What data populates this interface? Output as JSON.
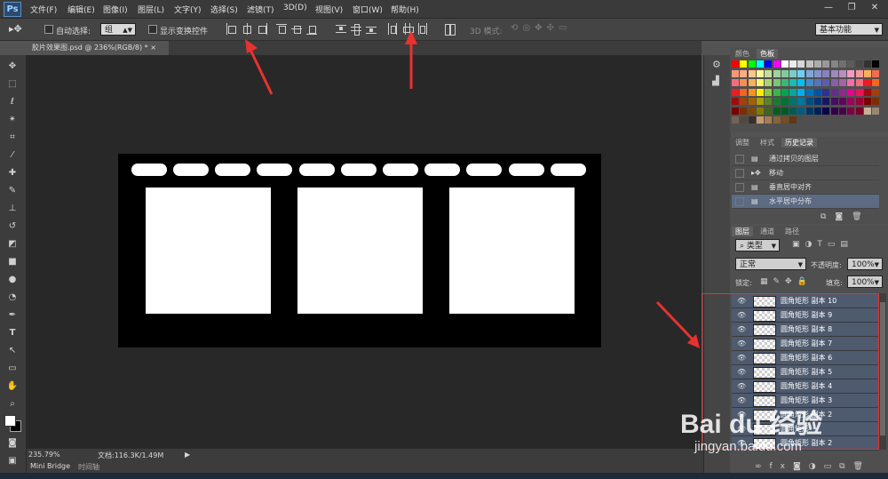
{
  "app": {
    "logo": "Ps"
  },
  "menu": [
    "文件(F)",
    "编辑(E)",
    "图像(I)",
    "图层(L)",
    "文字(Y)",
    "选择(S)",
    "滤镜(T)",
    "3D(D)",
    "视图(V)",
    "窗口(W)",
    "帮助(H)"
  ],
  "window_controls": [
    "—",
    "❐",
    "✕"
  ],
  "options": {
    "auto_select_label": "自动选择:",
    "auto_select_value": "组",
    "show_transform_label": "显示变换控件",
    "mode_3d_label": "3D 模式:",
    "workspace_value": "基本功能"
  },
  "document": {
    "tab_title": "胶片效果图.psd @ 236%(RGB/8) *",
    "tab_close": "×"
  },
  "status": {
    "zoom": "235.79%",
    "doc_info": "文档:116.3K/1.49M"
  },
  "bottom_tabs": [
    "Mini Bridge",
    "时间轴"
  ],
  "panels": {
    "color_tabs": [
      "颜色",
      "色板"
    ],
    "history_tabs": [
      "调整",
      "样式",
      "历史记录"
    ],
    "history_items": [
      "通过拷贝的图层",
      "移动",
      "垂直居中对齐",
      "水平居中分布"
    ],
    "layers_tabs": [
      "图层",
      "通道",
      "路径"
    ],
    "kind_label": "类型",
    "blend_mode": "正常",
    "opacity_label": "不透明度:",
    "opacity_value": "100%",
    "lock_label": "锁定:",
    "fill_label": "填充:",
    "fill_value": "100%",
    "layers": [
      "圆角矩形 副本 10",
      "圆角矩形 副本 9",
      "圆角矩形 副本 8",
      "圆角矩形 副本 7",
      "圆角矩形 副本 6",
      "圆角矩形 副本 5",
      "圆角矩形 副本 4",
      "圆角矩形 副本 3",
      "圆角矩形 副本 2",
      "圆角矩形",
      "圆角矩形 副本 2"
    ]
  },
  "watermark": {
    "brand": "Bai du 经验",
    "url": "jingyan.baidu.com"
  },
  "colors": {
    "accent_red": "#e8322f",
    "selected_layer": "#4e5a6e"
  }
}
